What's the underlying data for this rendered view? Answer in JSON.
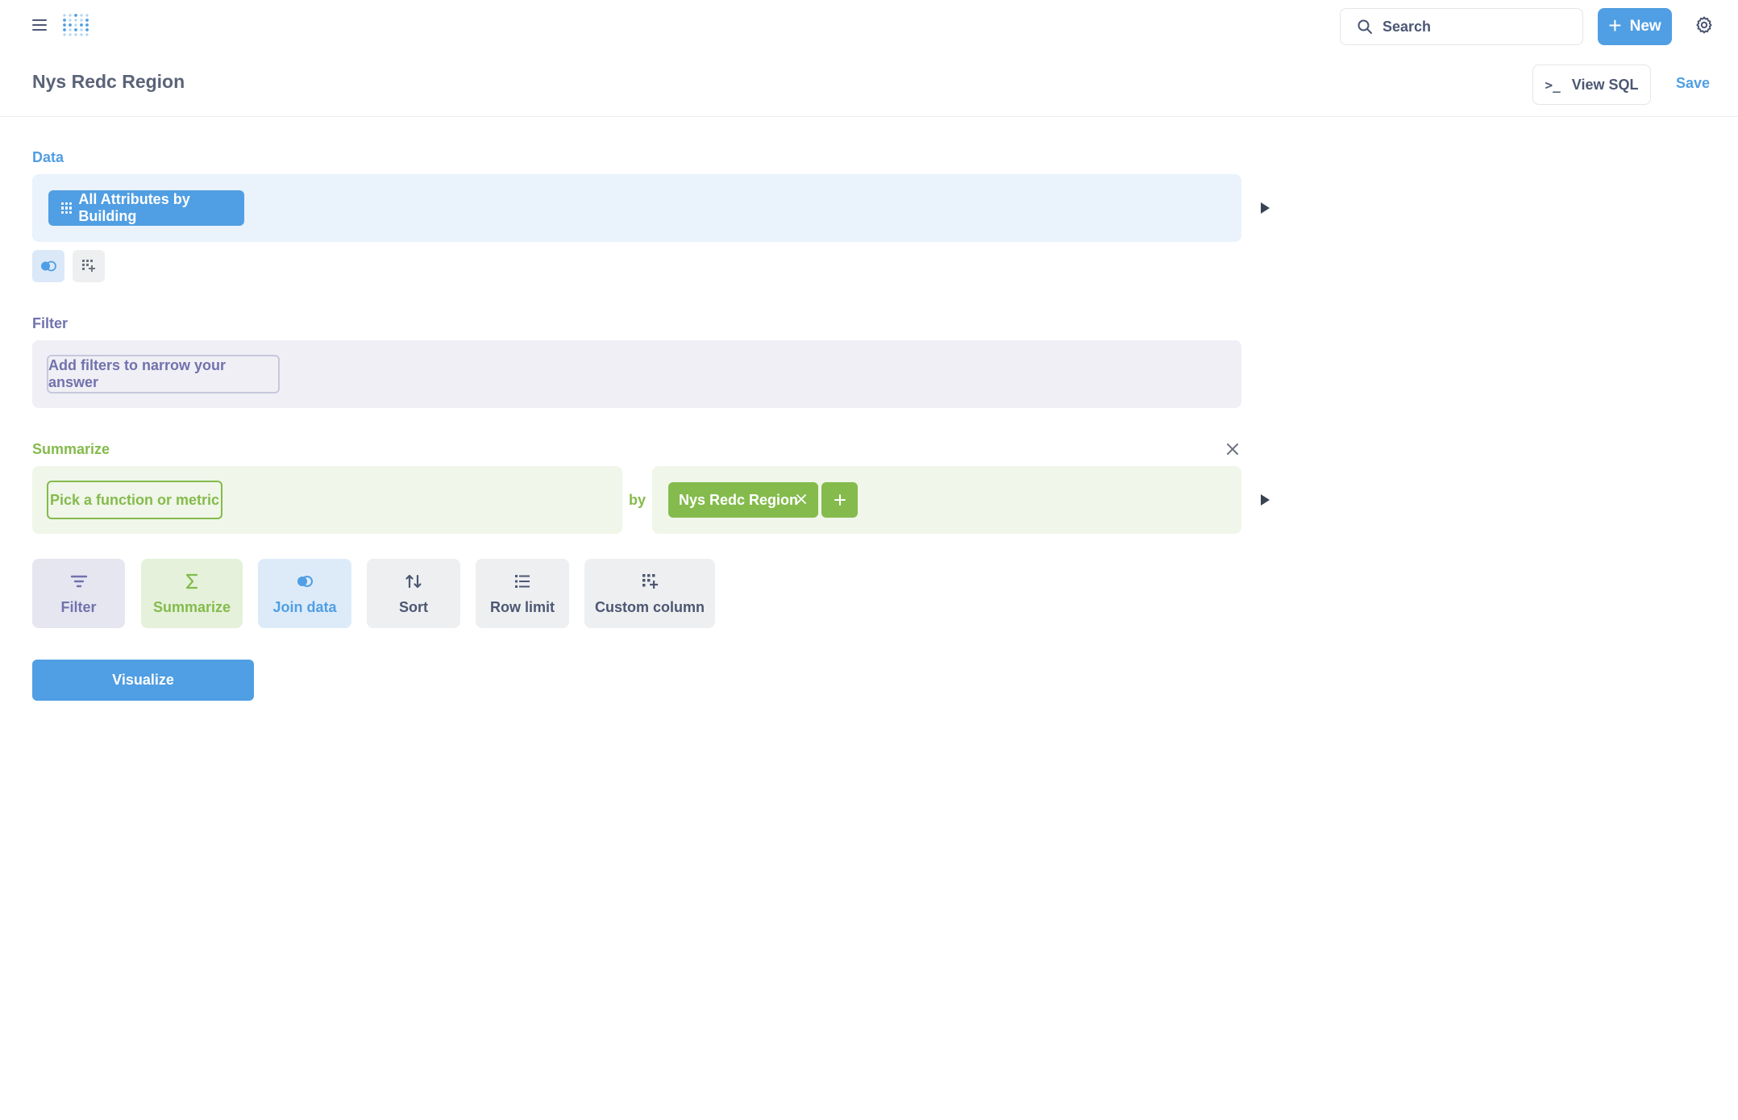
{
  "nav": {
    "menu_icon": "hamburger-icon",
    "logo_icon": "metabase-logo",
    "search_placeholder": "Search",
    "new_label": "New"
  },
  "header": {
    "title": "Nys Redc Region",
    "view_sql_label": "View SQL",
    "save_label": "Save"
  },
  "data_step": {
    "label": "Data",
    "table_name": "All Attributes by Building"
  },
  "filter_step": {
    "label": "Filter",
    "placeholder": "Add filters to narrow your answer"
  },
  "summarize_step": {
    "label": "Summarize",
    "metric_placeholder": "Pick a function or metric",
    "by_label": "by",
    "group_by": "Nys Redc Region"
  },
  "actions": [
    {
      "label": "Filter",
      "icon": "filter-icon"
    },
    {
      "label": "Summarize",
      "icon": "sum-icon"
    },
    {
      "label": "Join data",
      "icon": "join-icon"
    },
    {
      "label": "Sort",
      "icon": "sort-icon"
    },
    {
      "label": "Row limit",
      "icon": "list-icon"
    },
    {
      "label": "Custom column",
      "icon": "add-data-icon"
    }
  ],
  "visualize_label": "Visualize",
  "colors": {
    "brand": "#509ee3",
    "filter": "#7172ad",
    "summarize": "#84bb4c",
    "text": "#4c5773"
  }
}
